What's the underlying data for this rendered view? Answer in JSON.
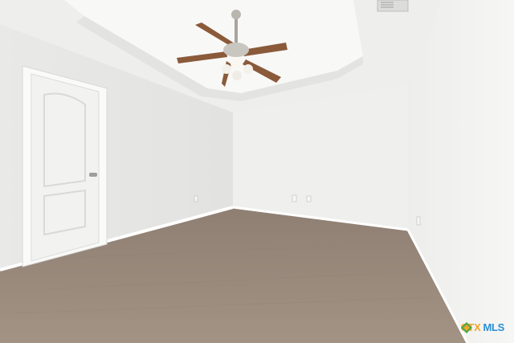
{
  "scene": {
    "description_tag": "empty-bedroom-photo",
    "colors": {
      "wall_left": "#e6e6e4",
      "wall_back": "#efefed",
      "wall_right": "#f4f4f3",
      "ceiling": "#f1f1f0",
      "tray_ceiling": "#f7f7f6",
      "carpet": "#9a8a7d",
      "baseboard": "#ffffff",
      "door": "#f2f2f0",
      "fan_blade": "#8a5a3a",
      "fan_metal": "#b9b6b0"
    }
  },
  "watermark": {
    "brand_left": "CTX",
    "brand_right": "MLS",
    "colors": {
      "left": "#f2a52b",
      "right": "#2a8fd6"
    }
  }
}
